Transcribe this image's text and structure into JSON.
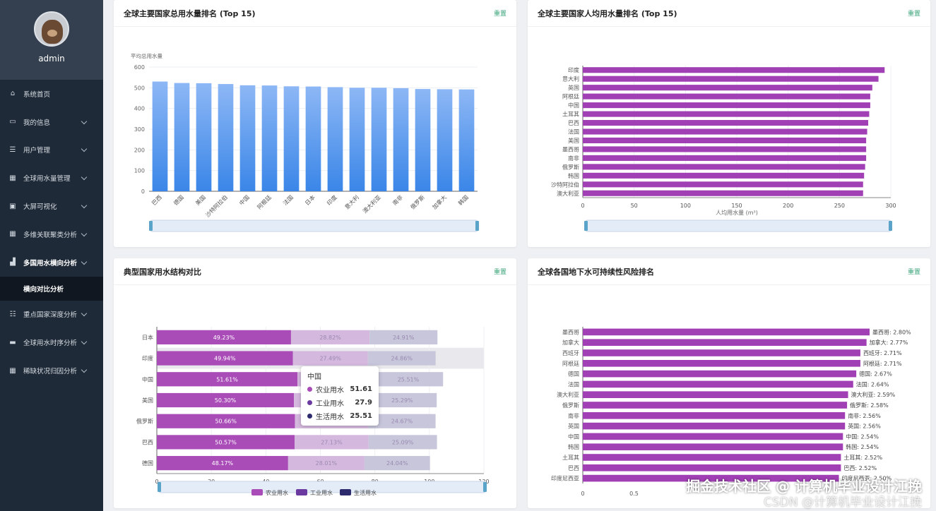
{
  "sidebar": {
    "username": "admin",
    "items": [
      {
        "label": "系统首页",
        "icon": "home-icon",
        "glyph": "⌂",
        "chevron": false
      },
      {
        "label": "我的信息",
        "icon": "profile-card-icon",
        "glyph": "▭",
        "chevron": true
      },
      {
        "label": "用户管理",
        "icon": "list-icon",
        "glyph": "☰",
        "chevron": true
      },
      {
        "label": "全球用水量管理",
        "icon": "grid-icon",
        "glyph": "▦",
        "chevron": true
      },
      {
        "label": "大屏可视化",
        "icon": "briefcase-icon",
        "glyph": "▣",
        "chevron": true
      },
      {
        "label": "多维关联聚类分析",
        "icon": "grid-icon",
        "glyph": "▦",
        "chevron": true
      },
      {
        "label": "多国用水横向分析",
        "icon": "bar-chart-icon",
        "glyph": "▟",
        "chevron": true,
        "active": true
      },
      {
        "label": "重点国家深度分析",
        "icon": "sliders-icon",
        "glyph": "☷",
        "chevron": true
      },
      {
        "label": "全球用水时序分析",
        "icon": "chat-icon",
        "glyph": "▬",
        "chevron": true
      },
      {
        "label": "稀缺状况归因分析",
        "icon": "grid-icon",
        "glyph": "▦",
        "chevron": true
      }
    ],
    "active_sub": "横向对比分析"
  },
  "reset_label": "重置",
  "panels": {
    "p1": {
      "title": "全球主要国家总用水量排名 (Top 15)"
    },
    "p2": {
      "title": "全球主要国家人均用水量排名 (Top 15)"
    },
    "p3": {
      "title": "典型国家用水结构对比"
    },
    "p4": {
      "title": "全球各国地下水可持续性风险排名"
    }
  },
  "tooltip": {
    "title": "中国",
    "rows": [
      {
        "name": "农业用水",
        "value": "51.61",
        "color": "#a94cb8"
      },
      {
        "name": "工业用水",
        "value": "27.9",
        "color": "#6b3aa0"
      },
      {
        "name": "生活用水",
        "value": "25.51",
        "color": "#2e2a6e"
      }
    ]
  },
  "watermark": "掘金技术社区 @ 计算机毕业设计江挽",
  "watermark2": "CSDN @计算机毕业设计江挽",
  "chart_data": [
    {
      "id": "p1",
      "type": "bar",
      "ylabel": "平均总用水量",
      "ylim": [
        0,
        600
      ],
      "yticks": [
        0,
        100,
        200,
        300,
        400,
        500,
        600
      ],
      "categories": [
        "巴西",
        "德国",
        "美国",
        "沙特阿拉伯",
        "中国",
        "阿根廷",
        "法国",
        "日本",
        "印度",
        "意大利",
        "澳大利亚",
        "南非",
        "俄罗斯",
        "加拿大",
        "韩国"
      ],
      "values": [
        530,
        523,
        522,
        518,
        512,
        511,
        507,
        506,
        503,
        500,
        500,
        498,
        494,
        493,
        492
      ],
      "color_top": "#8db7f5",
      "color_bottom": "#3a86e8"
    },
    {
      "id": "p2",
      "type": "bar",
      "orientation": "horizontal",
      "xlabel": "人均用水量 (m³)",
      "xlim": [
        0,
        300
      ],
      "xticks": [
        0,
        50,
        100,
        150,
        200,
        250,
        300
      ],
      "categories": [
        "印度",
        "意大利",
        "英国",
        "阿根廷",
        "中国",
        "土耳其",
        "巴西",
        "法国",
        "美国",
        "墨西哥",
        "南非",
        "俄罗斯",
        "韩国",
        "沙特阿拉伯",
        "澳大利亚"
      ],
      "values": [
        294,
        288,
        282,
        280,
        280,
        279,
        278,
        277,
        276,
        276,
        276,
        275,
        274,
        273,
        273
      ],
      "color": "#a13fb5"
    },
    {
      "id": "p3",
      "type": "bar",
      "orientation": "horizontal",
      "stacked": true,
      "xlim": [
        0,
        120
      ],
      "xticks": [
        0,
        20,
        40,
        60,
        80,
        100,
        120
      ],
      "categories": [
        "日本",
        "印度",
        "中国",
        "美国",
        "俄罗斯",
        "巴西",
        "德国"
      ],
      "series": [
        {
          "name": "农业用水",
          "values": [
            49.23,
            49.94,
            51.61,
            50.3,
            50.66,
            50.57,
            48.17
          ],
          "labels": [
            "49.23%",
            "49.94%",
            "51.61%",
            "50.30%",
            "50.66%",
            "50.57%",
            "48.17%"
          ],
          "color": "#a94cb8"
        },
        {
          "name": "工业用水",
          "values": [
            28.82,
            27.49,
            27.9,
            27.1,
            26.94,
            27.13,
            28.01
          ],
          "labels": [
            "28.82%",
            "27.49%",
            "",
            "",
            "",
            "27.13%",
            "28.01%"
          ],
          "color": "#d5b8de"
        },
        {
          "name": "生活用水",
          "values": [
            24.91,
            24.86,
            25.51,
            25.29,
            24.67,
            25.09,
            24.04
          ],
          "labels": [
            "24.91%",
            "24.86%",
            "25.51%",
            "25.29%",
            "24.67%",
            "25.09%",
            "24.04%"
          ],
          "color": "#c7c6db"
        }
      ],
      "legend_colors": [
        "#a94cb8",
        "#6b3aa0",
        "#2e2a6e"
      ],
      "highlight": "印度"
    },
    {
      "id": "p4",
      "type": "bar",
      "orientation": "horizontal",
      "xlim": [
        0,
        3.2
      ],
      "categories": [
        "墨西哥",
        "加拿大",
        "西班牙",
        "阿根廷",
        "德国",
        "法国",
        "澳大利亚",
        "俄罗斯",
        "南非",
        "英国",
        "中国",
        "韩国",
        "土耳其",
        "巴西",
        "印度尼西亚"
      ],
      "values": [
        2.8,
        2.77,
        2.71,
        2.71,
        2.67,
        2.64,
        2.59,
        2.58,
        2.56,
        2.56,
        2.54,
        2.54,
        2.52,
        2.52,
        2.5
      ],
      "labels": [
        "墨西哥: 2.80%",
        "加拿大: 2.77%",
        "西班牙: 2.71%",
        "阿根廷: 2.71%",
        "德国: 2.67%",
        "法国: 2.64%",
        "澳大利亚: 2.59%",
        "俄罗斯: 2.58%",
        "南非: 2.56%",
        "英国: 2.56%",
        "中国: 2.54%",
        "韩国: 2.54%",
        "土耳其: 2.52%",
        "巴西: 2.52%",
        "印度尼西亚: 2.50%"
      ],
      "xtick_labels": [
        "0",
        "0.5"
      ],
      "color": "#a13fb5"
    }
  ]
}
